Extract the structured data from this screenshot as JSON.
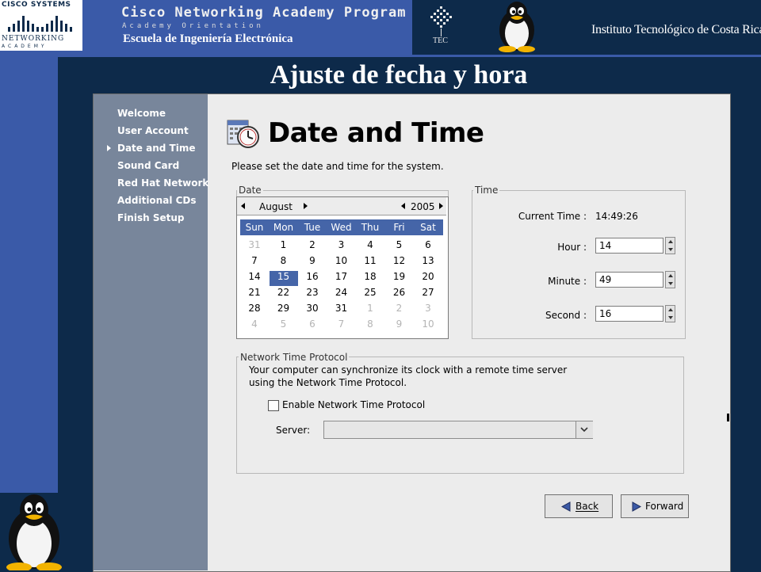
{
  "banner": {
    "cisco_brand": "Cisco Systems",
    "cisco_networking": "Networking",
    "cisco_academy": "Academy",
    "program_title": "Cisco Networking Academy Program",
    "program_subtitle": "Academy Orientation",
    "school": "Escuela de Ingeniería Electrónica",
    "tec_label": "TEC",
    "institute": "Instituto Tecnológico de Costa Rica"
  },
  "slide_title": "Ajuste de fecha y hora",
  "sidebar": {
    "items": [
      "Welcome",
      "User Account",
      "Date and Time",
      "Sound Card",
      "Red Hat Network",
      "Additional CDs",
      "Finish Setup"
    ],
    "active": "Date and Time"
  },
  "page": {
    "title": "Date and Time",
    "description": "Please set the date and time for the system."
  },
  "date": {
    "group_label": "Date",
    "month": "August",
    "year": "2005",
    "day_names": [
      "Sun",
      "Mon",
      "Tue",
      "Wed",
      "Thu",
      "Fri",
      "Sat"
    ],
    "weeks": [
      [
        "31",
        "1",
        "2",
        "3",
        "4",
        "5",
        "6"
      ],
      [
        "7",
        "8",
        "9",
        "10",
        "11",
        "12",
        "13"
      ],
      [
        "14",
        "15",
        "16",
        "17",
        "18",
        "19",
        "20"
      ],
      [
        "21",
        "22",
        "23",
        "24",
        "25",
        "26",
        "27"
      ],
      [
        "28",
        "29",
        "30",
        "31",
        "1",
        "2",
        "3"
      ],
      [
        "4",
        "5",
        "6",
        "7",
        "8",
        "9",
        "10"
      ]
    ],
    "selected_day": "15"
  },
  "time": {
    "group_label": "Time",
    "current_label": "Current Time :",
    "current_value": "14:49:26",
    "hour_label": "Hour :",
    "hour_value": "14",
    "minute_label": "Minute :",
    "minute_value": "49",
    "second_label": "Second :",
    "second_value": "16"
  },
  "ntp": {
    "group_label": "Network Time Protocol",
    "desc_line1": "Your computer can synchronize its clock with a remote time server",
    "desc_line2": "using the Network Time Protocol.",
    "enable_label": "Enable Network Time Protocol",
    "enabled": false,
    "server_label": "Server:",
    "server_value": ""
  },
  "buttons": {
    "back_label": "Back",
    "forward_label": "Forward"
  },
  "colors": {
    "banner_blue": "#3a5aa8",
    "navy": "#0d2a4a",
    "sidebar": "#78869b",
    "selection": "#4565a8",
    "window": "#ececec"
  }
}
